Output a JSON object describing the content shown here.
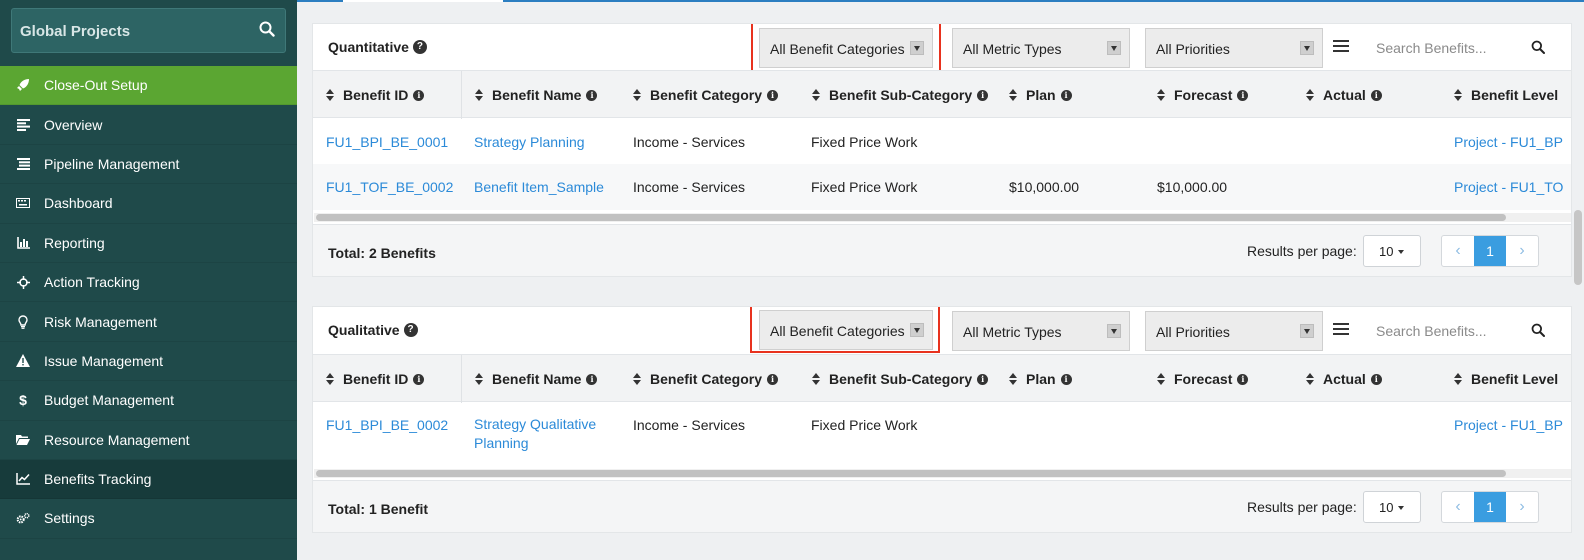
{
  "sidebar": {
    "search_title": "Global Projects",
    "items": [
      {
        "label": "Close-Out Setup",
        "icon": "rocket-icon"
      },
      {
        "label": "Overview",
        "icon": "align-left-icon"
      },
      {
        "label": "Pipeline Management",
        "icon": "list-icon"
      },
      {
        "label": "Dashboard",
        "icon": "keyboard-icon"
      },
      {
        "label": "Reporting",
        "icon": "bar-chart-icon"
      },
      {
        "label": "Action Tracking",
        "icon": "crosshair-icon"
      },
      {
        "label": "Risk Management",
        "icon": "lightbulb-icon"
      },
      {
        "label": "Issue Management",
        "icon": "warning-icon"
      },
      {
        "label": "Budget Management",
        "icon": "dollar-icon"
      },
      {
        "label": "Resource Management",
        "icon": "folder-open-icon"
      },
      {
        "label": "Benefits Tracking",
        "icon": "line-chart-icon"
      },
      {
        "label": "Settings",
        "icon": "cogs-icon"
      }
    ],
    "active_color": "#5ba632",
    "bg_color": "#1f4a4a"
  },
  "filters": {
    "category": "All Benefit Categories",
    "metric": "All Metric Types",
    "priority": "All Priorities",
    "search_placeholder": "Search Benefits..."
  },
  "columns": [
    "Benefit ID",
    "Benefit Name",
    "Benefit Category",
    "Benefit Sub-Category",
    "Plan",
    "Forecast",
    "Actual",
    "Benefit Level"
  ],
  "quantitative": {
    "title": "Quantitative",
    "rows": [
      {
        "id": "FU1_BPI_BE_0001",
        "name": "Strategy Planning",
        "category": "Income - Services",
        "subcategory": "Fixed Price Work",
        "plan": "",
        "forecast": "",
        "actual": "",
        "level": "Project - FU1_BP"
      },
      {
        "id": "FU1_TOF_BE_0002",
        "name": "Benefit Item_Sample",
        "category": "Income - Services",
        "subcategory": "Fixed Price Work",
        "plan": "$10,000.00",
        "forecast": "$10,000.00",
        "actual": "",
        "level": "Project - FU1_TO"
      }
    ],
    "total": "Total: 2 Benefits"
  },
  "qualitative": {
    "title": "Qualitative",
    "rows": [
      {
        "id": "FU1_BPI_BE_0002",
        "name": "Strategy Qualitative Planning",
        "category": "Income - Services",
        "subcategory": "Fixed Price Work",
        "plan": "",
        "forecast": "",
        "actual": "",
        "level": "Project - FU1_BP"
      }
    ],
    "total": "Total: 1 Benefit"
  },
  "pagination": {
    "results_per_page_label": "Results per page:",
    "per_page": "10",
    "current_page": "1",
    "prev": "‹",
    "next": "›"
  },
  "accent": "#2b8ad8",
  "highlight_color": "#e8321e"
}
